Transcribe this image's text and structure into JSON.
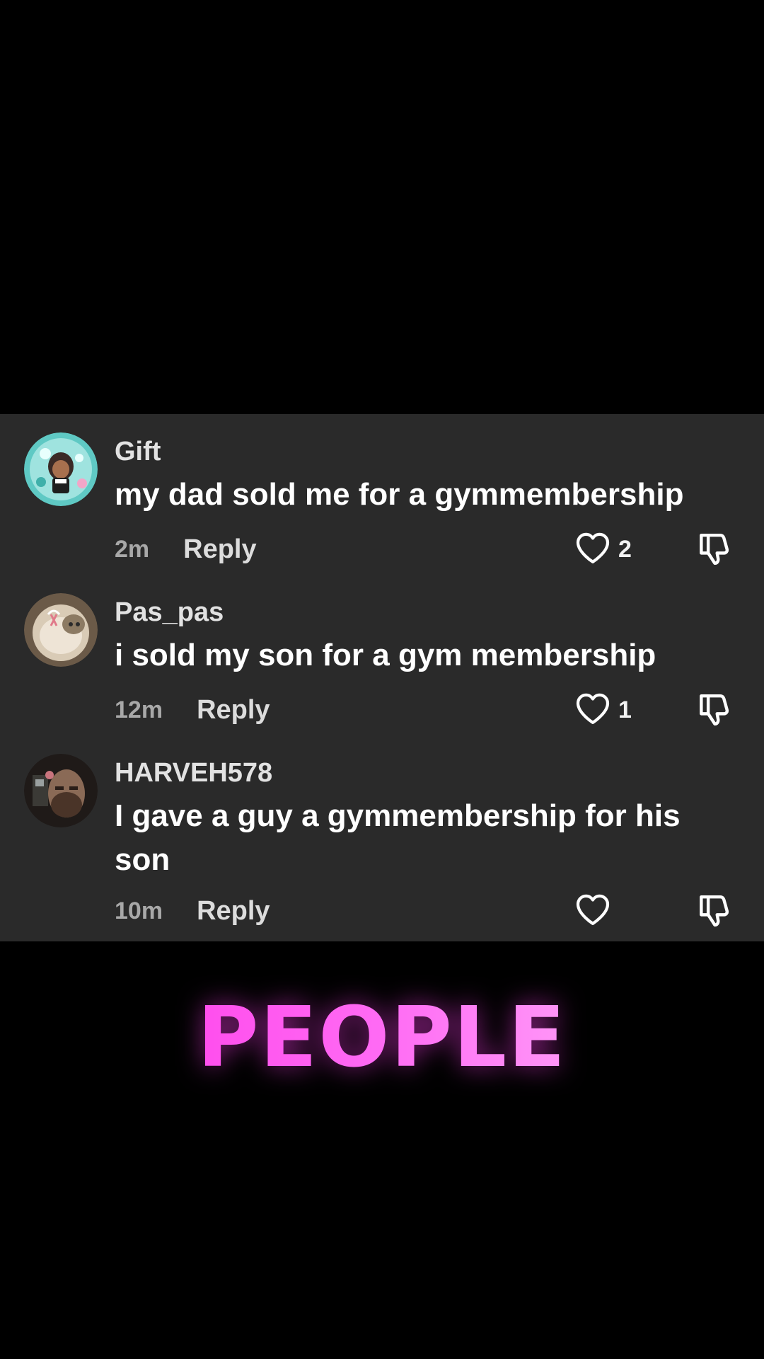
{
  "comments": [
    {
      "username": "Gift",
      "text": "my dad sold me for a gymmembership",
      "time": "2m",
      "reply_label": "Reply",
      "likes": "2"
    },
    {
      "username": "Pas_pas",
      "text": "i sold my son for a gym membership",
      "time": "12m",
      "reply_label": "Reply",
      "likes": "1"
    },
    {
      "username": "HARVEH578",
      "text": "I gave a guy a gymmembership for his son",
      "time": "10m",
      "reply_label": "Reply",
      "likes": ""
    }
  ],
  "caption": "PEOPLE",
  "icons": {
    "like": "heart-outline-icon",
    "dislike": "thumbs-down-icon"
  },
  "colors": {
    "panel_background": "#2a2a2a",
    "caption_gradient_start": "#ff2fe6",
    "caption_gradient_end": "#ffc2fb"
  }
}
